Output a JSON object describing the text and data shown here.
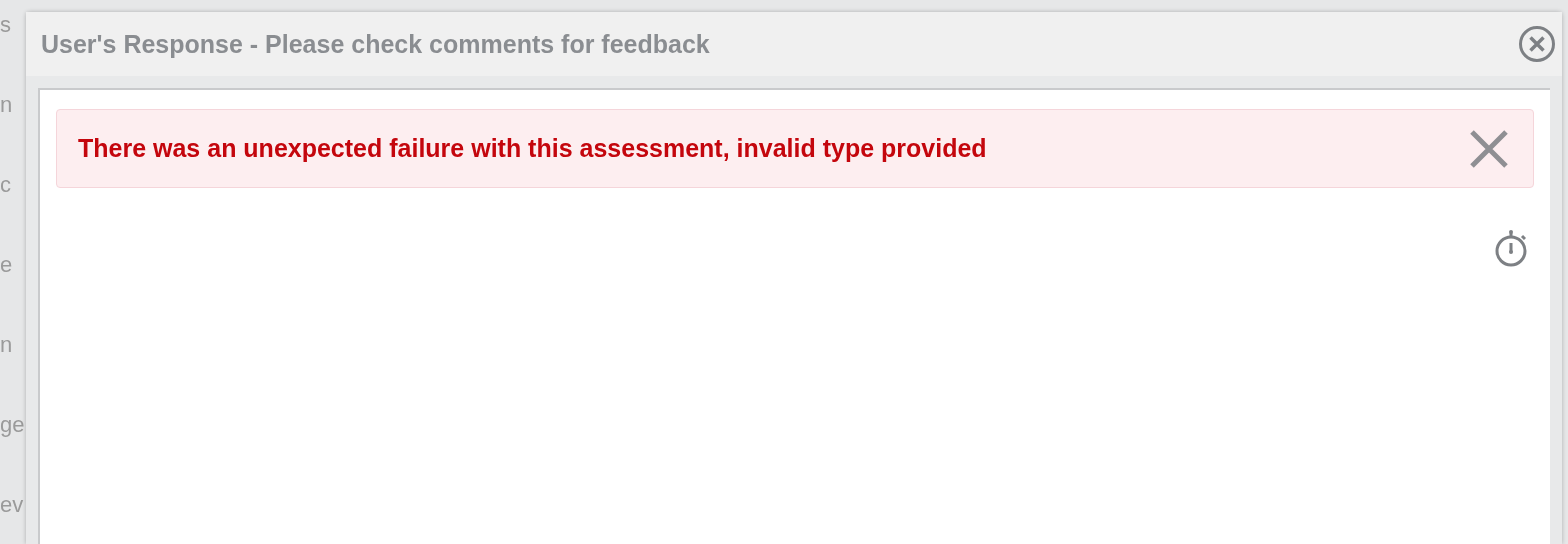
{
  "background_fragments": [
    "s",
    "n",
    "c",
    "e",
    "n",
    "ge",
    "ev"
  ],
  "dialog": {
    "title": "User's Response - Please check comments for feedback"
  },
  "alert": {
    "message": "There was an unexpected failure with this assessment, invalid type provided"
  }
}
